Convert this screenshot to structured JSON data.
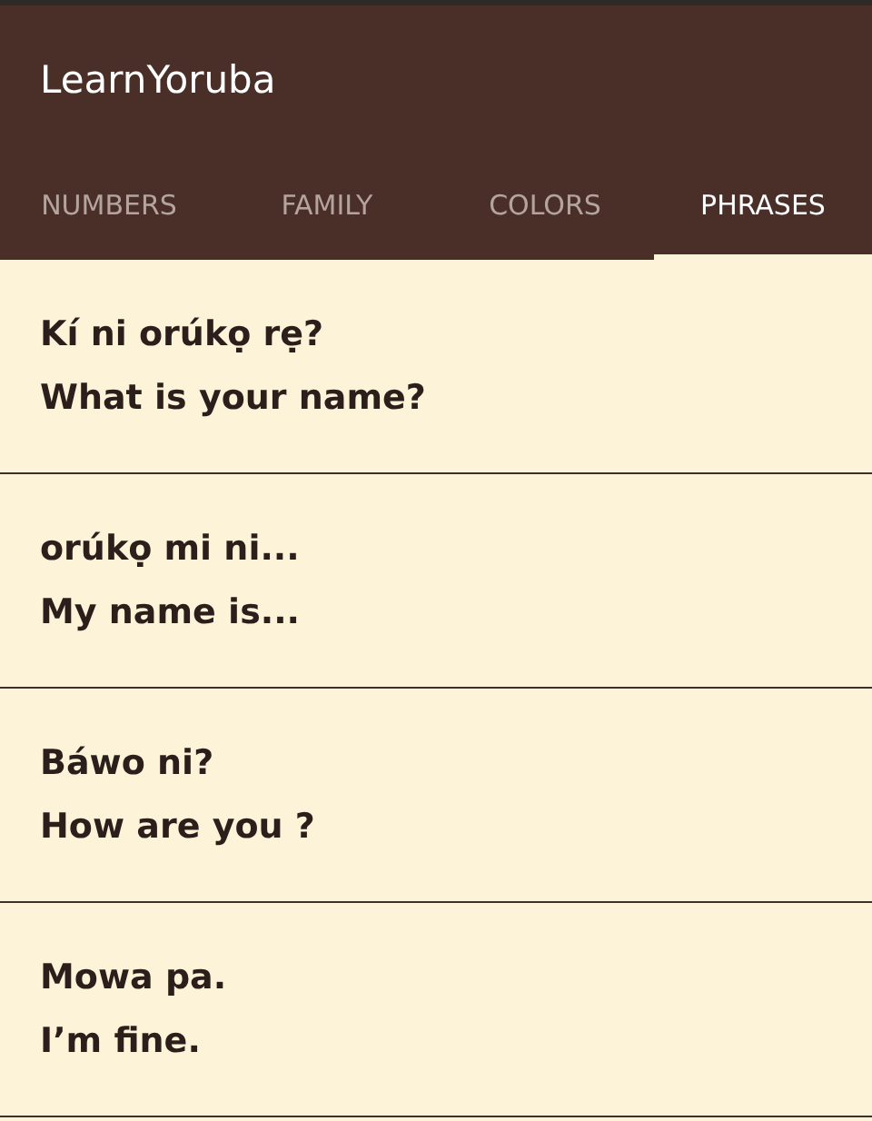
{
  "app_bar": {
    "title": "LearnYoruba"
  },
  "tabs": [
    {
      "label": "NUMBERS",
      "selected": false
    },
    {
      "label": "FAMILY",
      "selected": false
    },
    {
      "label": "COLORS",
      "selected": false
    },
    {
      "label": "PHRASES",
      "selected": true
    }
  ],
  "phrases": [
    {
      "yoruba": "Kí ni orúkọ rẹ?",
      "english": "What is your name?"
    },
    {
      "yoruba": "orúkọ mi ni...",
      "english": "My name is..."
    },
    {
      "yoruba": "Báwo ni?",
      "english": "How are you ?"
    },
    {
      "yoruba": "Mowa pa.",
      "english": "I’m fine."
    }
  ]
}
